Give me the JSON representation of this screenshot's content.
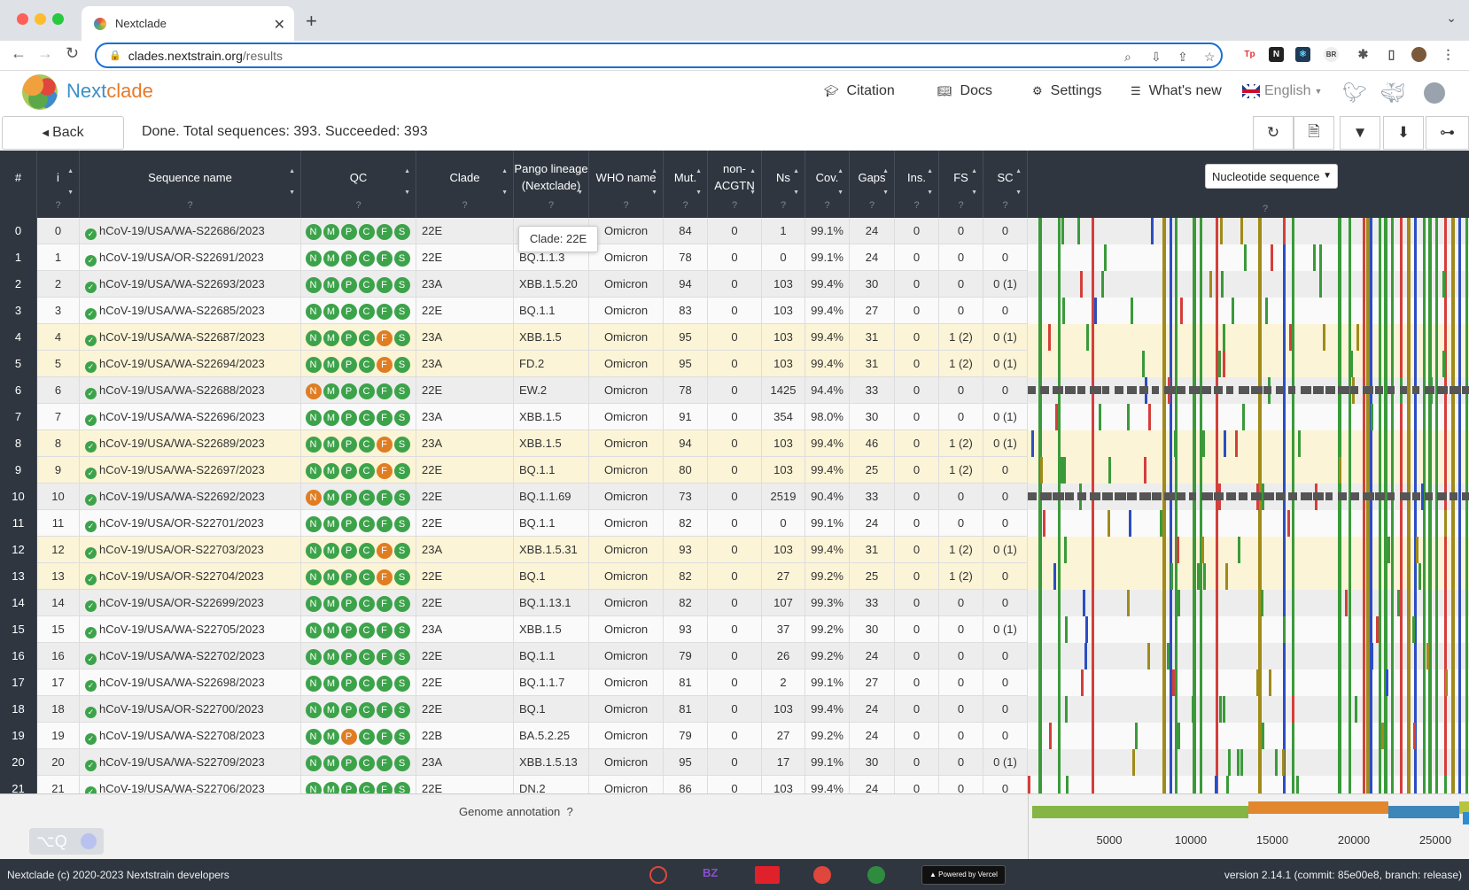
{
  "browser": {
    "tab_title": "Nextclade",
    "url_host": "clades.nextstrain.org",
    "url_path": "/results"
  },
  "nav": {
    "brand_a": "Next",
    "brand_b": "clade",
    "citation": "Citation",
    "docs": "Docs",
    "settings": "Settings",
    "whats_new": "What's new",
    "language": "English"
  },
  "status": {
    "back_label": "Back",
    "text": "Done. Total sequences: 393. Succeeded: 393"
  },
  "table": {
    "columns": [
      {
        "key": "hash",
        "label": "#",
        "q": ""
      },
      {
        "key": "i",
        "label": "i",
        "q": "?"
      },
      {
        "key": "name",
        "label": "Sequence name",
        "q": "?"
      },
      {
        "key": "qc",
        "label": "QC",
        "q": "?"
      },
      {
        "key": "clade",
        "label": "Clade",
        "q": "?"
      },
      {
        "key": "pango",
        "label": "Pango lineage (Nextclade)",
        "q": "?"
      },
      {
        "key": "who",
        "label": "WHO name",
        "q": "?"
      },
      {
        "key": "mut",
        "label": "Mut.",
        "q": "?"
      },
      {
        "key": "nonacgtn",
        "label": "non-ACGTN",
        "q": "?"
      },
      {
        "key": "ns",
        "label": "Ns",
        "q": "?"
      },
      {
        "key": "cov",
        "label": "Cov.",
        "q": "?"
      },
      {
        "key": "gaps",
        "label": "Gaps",
        "q": "?"
      },
      {
        "key": "ins",
        "label": "Ins.",
        "q": "?"
      },
      {
        "key": "fs",
        "label": "FS",
        "q": "?"
      },
      {
        "key": "sc",
        "label": "SC",
        "q": "?"
      }
    ],
    "view_select": "Nucleotide sequence",
    "view_q": "?",
    "qc_letters": [
      "N",
      "M",
      "P",
      "C",
      "F",
      "S"
    ],
    "rows": [
      {
        "idx": "0",
        "i": "0",
        "name": "hCoV-19/USA/WA-S22686/2023",
        "qc": "gggggg",
        "clade": "22E",
        "pango": "",
        "who": "Omicron",
        "mut": "84",
        "nonacgtn": "0",
        "ns": "1",
        "cov": "99.1%",
        "gaps": "24",
        "ins": "0",
        "fs": "0",
        "sc": "0",
        "hl": false
      },
      {
        "idx": "1",
        "i": "1",
        "name": "hCoV-19/USA/OR-S22691/2023",
        "qc": "gggggg",
        "clade": "22E",
        "pango": "BQ.1.1.3",
        "who": "Omicron",
        "mut": "78",
        "nonacgtn": "0",
        "ns": "0",
        "cov": "99.1%",
        "gaps": "24",
        "ins": "0",
        "fs": "0",
        "sc": "0",
        "hl": false
      },
      {
        "idx": "2",
        "i": "2",
        "name": "hCoV-19/USA/WA-S22693/2023",
        "qc": "gggggg",
        "clade": "23A",
        "pango": "XBB.1.5.20",
        "who": "Omicron",
        "mut": "94",
        "nonacgtn": "0",
        "ns": "103",
        "cov": "99.4%",
        "gaps": "30",
        "ins": "0",
        "fs": "0",
        "sc": "0 (1)",
        "hl": false
      },
      {
        "idx": "3",
        "i": "3",
        "name": "hCoV-19/USA/WA-S22685/2023",
        "qc": "gggggg",
        "clade": "22E",
        "pango": "BQ.1.1",
        "who": "Omicron",
        "mut": "83",
        "nonacgtn": "0",
        "ns": "103",
        "cov": "99.4%",
        "gaps": "27",
        "ins": "0",
        "fs": "0",
        "sc": "0",
        "hl": false
      },
      {
        "idx": "4",
        "i": "4",
        "name": "hCoV-19/USA/WA-S22687/2023",
        "qc": "ggggog",
        "clade": "23A",
        "pango": "XBB.1.5",
        "who": "Omicron",
        "mut": "95",
        "nonacgtn": "0",
        "ns": "103",
        "cov": "99.4%",
        "gaps": "31",
        "ins": "0",
        "fs": "1 (2)",
        "sc": "0 (1)",
        "hl": true
      },
      {
        "idx": "5",
        "i": "5",
        "name": "hCoV-19/USA/WA-S22694/2023",
        "qc": "ggggog",
        "clade": "23A",
        "pango": "FD.2",
        "who": "Omicron",
        "mut": "95",
        "nonacgtn": "0",
        "ns": "103",
        "cov": "99.4%",
        "gaps": "31",
        "ins": "0",
        "fs": "1 (2)",
        "sc": "0 (1)",
        "hl": true
      },
      {
        "idx": "6",
        "i": "6",
        "name": "hCoV-19/USA/WA-S22688/2023",
        "qc": "oggggg",
        "clade": "22E",
        "pango": "EW.2",
        "who": "Omicron",
        "mut": "78",
        "nonacgtn": "0",
        "ns": "1425",
        "cov": "94.4%",
        "gaps": "33",
        "ins": "0",
        "fs": "0",
        "sc": "0",
        "hl": false
      },
      {
        "idx": "7",
        "i": "7",
        "name": "hCoV-19/USA/WA-S22696/2023",
        "qc": "gggggg",
        "clade": "23A",
        "pango": "XBB.1.5",
        "who": "Omicron",
        "mut": "91",
        "nonacgtn": "0",
        "ns": "354",
        "cov": "98.0%",
        "gaps": "30",
        "ins": "0",
        "fs": "0",
        "sc": "0 (1)",
        "hl": false
      },
      {
        "idx": "8",
        "i": "8",
        "name": "hCoV-19/USA/WA-S22689/2023",
        "qc": "ggggog",
        "clade": "23A",
        "pango": "XBB.1.5",
        "who": "Omicron",
        "mut": "94",
        "nonacgtn": "0",
        "ns": "103",
        "cov": "99.4%",
        "gaps": "46",
        "ins": "0",
        "fs": "1 (2)",
        "sc": "0 (1)",
        "hl": true
      },
      {
        "idx": "9",
        "i": "9",
        "name": "hCoV-19/USA/WA-S22697/2023",
        "qc": "ggggog",
        "clade": "22E",
        "pango": "BQ.1.1",
        "who": "Omicron",
        "mut": "80",
        "nonacgtn": "0",
        "ns": "103",
        "cov": "99.4%",
        "gaps": "25",
        "ins": "0",
        "fs": "1 (2)",
        "sc": "0",
        "hl": true
      },
      {
        "idx": "10",
        "i": "10",
        "name": "hCoV-19/USA/WA-S22692/2023",
        "qc": "oggggg",
        "clade": "22E",
        "pango": "BQ.1.1.69",
        "who": "Omicron",
        "mut": "73",
        "nonacgtn": "0",
        "ns": "2519",
        "cov": "90.4%",
        "gaps": "33",
        "ins": "0",
        "fs": "0",
        "sc": "0",
        "hl": false
      },
      {
        "idx": "11",
        "i": "11",
        "name": "hCoV-19/USA/OR-S22701/2023",
        "qc": "gggggg",
        "clade": "22E",
        "pango": "BQ.1.1",
        "who": "Omicron",
        "mut": "82",
        "nonacgtn": "0",
        "ns": "0",
        "cov": "99.1%",
        "gaps": "24",
        "ins": "0",
        "fs": "0",
        "sc": "0",
        "hl": false
      },
      {
        "idx": "12",
        "i": "12",
        "name": "hCoV-19/USA/OR-S22703/2023",
        "qc": "ggggog",
        "clade": "23A",
        "pango": "XBB.1.5.31",
        "who": "Omicron",
        "mut": "93",
        "nonacgtn": "0",
        "ns": "103",
        "cov": "99.4%",
        "gaps": "31",
        "ins": "0",
        "fs": "1 (2)",
        "sc": "0 (1)",
        "hl": true
      },
      {
        "idx": "13",
        "i": "13",
        "name": "hCoV-19/USA/OR-S22704/2023",
        "qc": "ggggog",
        "clade": "22E",
        "pango": "BQ.1",
        "who": "Omicron",
        "mut": "82",
        "nonacgtn": "0",
        "ns": "27",
        "cov": "99.2%",
        "gaps": "25",
        "ins": "0",
        "fs": "1 (2)",
        "sc": "0",
        "hl": true
      },
      {
        "idx": "14",
        "i": "14",
        "name": "hCoV-19/USA/OR-S22699/2023",
        "qc": "gggggg",
        "clade": "22E",
        "pango": "BQ.1.13.1",
        "who": "Omicron",
        "mut": "82",
        "nonacgtn": "0",
        "ns": "107",
        "cov": "99.3%",
        "gaps": "33",
        "ins": "0",
        "fs": "0",
        "sc": "0",
        "hl": false
      },
      {
        "idx": "15",
        "i": "15",
        "name": "hCoV-19/USA/WA-S22705/2023",
        "qc": "gggggg",
        "clade": "23A",
        "pango": "XBB.1.5",
        "who": "Omicron",
        "mut": "93",
        "nonacgtn": "0",
        "ns": "37",
        "cov": "99.2%",
        "gaps": "30",
        "ins": "0",
        "fs": "0",
        "sc": "0 (1)",
        "hl": false
      },
      {
        "idx": "16",
        "i": "16",
        "name": "hCoV-19/USA/WA-S22702/2023",
        "qc": "gggggg",
        "clade": "22E",
        "pango": "BQ.1.1",
        "who": "Omicron",
        "mut": "79",
        "nonacgtn": "0",
        "ns": "26",
        "cov": "99.2%",
        "gaps": "24",
        "ins": "0",
        "fs": "0",
        "sc": "0",
        "hl": false
      },
      {
        "idx": "17",
        "i": "17",
        "name": "hCoV-19/USA/WA-S22698/2023",
        "qc": "gggggg",
        "clade": "22E",
        "pango": "BQ.1.1.7",
        "who": "Omicron",
        "mut": "81",
        "nonacgtn": "0",
        "ns": "2",
        "cov": "99.1%",
        "gaps": "27",
        "ins": "0",
        "fs": "0",
        "sc": "0",
        "hl": false
      },
      {
        "idx": "18",
        "i": "18",
        "name": "hCoV-19/USA/OR-S22700/2023",
        "qc": "gggggg",
        "clade": "22E",
        "pango": "BQ.1",
        "who": "Omicron",
        "mut": "81",
        "nonacgtn": "0",
        "ns": "103",
        "cov": "99.4%",
        "gaps": "24",
        "ins": "0",
        "fs": "0",
        "sc": "0",
        "hl": false
      },
      {
        "idx": "19",
        "i": "19",
        "name": "hCoV-19/USA/WA-S22708/2023",
        "qc": "ggoggg",
        "clade": "22B",
        "pango": "BA.5.2.25",
        "who": "Omicron",
        "mut": "79",
        "nonacgtn": "0",
        "ns": "27",
        "cov": "99.2%",
        "gaps": "24",
        "ins": "0",
        "fs": "0",
        "sc": "0",
        "hl": false
      },
      {
        "idx": "20",
        "i": "20",
        "name": "hCoV-19/USA/WA-S22709/2023",
        "qc": "gggggg",
        "clade": "23A",
        "pango": "XBB.1.5.13",
        "who": "Omicron",
        "mut": "95",
        "nonacgtn": "0",
        "ns": "17",
        "cov": "99.1%",
        "gaps": "30",
        "ins": "0",
        "fs": "0",
        "sc": "0 (1)",
        "hl": false
      },
      {
        "idx": "21",
        "i": "21",
        "name": "hCoV-19/USA/WA-S22706/2023",
        "qc": "gggggg",
        "clade": "22E",
        "pango": "DN.2",
        "who": "Omicron",
        "mut": "86",
        "nonacgtn": "0",
        "ns": "103",
        "cov": "99.4%",
        "gaps": "24",
        "ins": "0",
        "fs": "0",
        "sc": "0",
        "hl": false
      }
    ]
  },
  "tooltip": "Clade: 22E",
  "genome": {
    "label": "Genome annotation",
    "q": "?",
    "ticks": [
      "5000",
      "10000",
      "15000",
      "20000",
      "25000"
    ]
  },
  "footer": {
    "copyright": "Nextclade (c) 2020-2023 Nextstrain developers",
    "vercel": "Powered by Vercel",
    "version": "version 2.14.1 (commit: 85e00e8, branch: release)"
  },
  "colors": {
    "header_bg": "#2f3640",
    "highlight_row": "#fcf4d6",
    "qc_good": "#3ca34a",
    "qc_warn": "#e07d22",
    "mut_A": "#d43f3a",
    "mut_C": "#2c4dc2",
    "mut_G": "#3a9a3a",
    "mut_T": "#a08a1a",
    "missing": "#555555"
  }
}
